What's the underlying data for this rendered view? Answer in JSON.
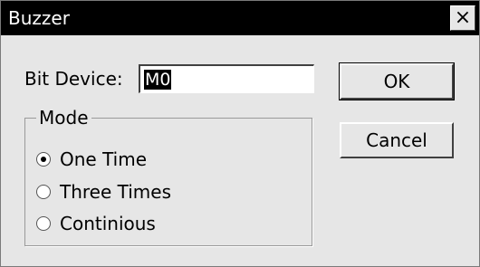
{
  "window": {
    "title": "Buzzer",
    "close_label": "×"
  },
  "bit_device": {
    "label": "Bit Device:",
    "value": "M0"
  },
  "buttons": {
    "ok": "OK",
    "cancel": "Cancel"
  },
  "mode": {
    "label": "Mode",
    "options": [
      {
        "label": "One Time",
        "selected": true
      },
      {
        "label": "Three Times",
        "selected": false
      },
      {
        "label": "Continious",
        "selected": false
      }
    ]
  },
  "colors": {
    "titlebar": "#000000",
    "dialog_bg": "#e6e6e6"
  }
}
